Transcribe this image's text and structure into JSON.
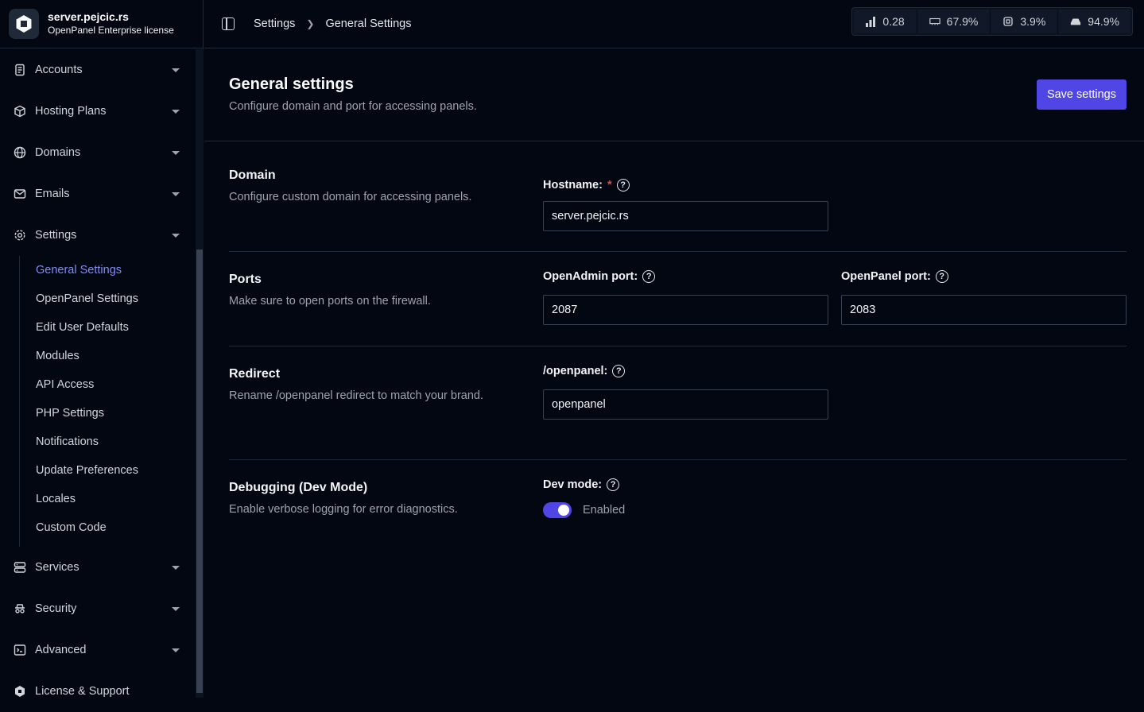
{
  "brand": {
    "server": "server.pejcic.rs",
    "license": "OpenPanel Enterprise license"
  },
  "sidebar": {
    "top_items": [
      {
        "label": "Accounts",
        "icon": "file-text-icon"
      },
      {
        "label": "Hosting Plans",
        "icon": "package-icon"
      },
      {
        "label": "Domains",
        "icon": "globe-icon"
      },
      {
        "label": "Emails",
        "icon": "mail-icon"
      },
      {
        "label": "Settings",
        "icon": "gear-icon"
      }
    ],
    "settings_sub": [
      "General Settings",
      "OpenPanel Settings",
      "Edit User Defaults",
      "Modules",
      "API Access",
      "PHP Settings",
      "Notifications",
      "Update Preferences",
      "Locales",
      "Custom Code"
    ],
    "bottom_items": [
      {
        "label": "Services",
        "icon": "server-icon"
      },
      {
        "label": "Security",
        "icon": "spy-icon"
      },
      {
        "label": "Advanced",
        "icon": "terminal-icon"
      },
      {
        "label": "License & Support",
        "icon": "openpanel-icon"
      }
    ]
  },
  "breadcrumb": {
    "parent": "Settings",
    "current": "General Settings"
  },
  "stats": {
    "load": "0.28",
    "ram": "67.9%",
    "cpu": "3.9%",
    "disk": "94.9%"
  },
  "page": {
    "title": "General settings",
    "description": "Configure domain and port for accessing panels.",
    "save_label": "Save settings"
  },
  "sections": {
    "domain": {
      "title": "Domain",
      "desc": "Configure custom domain for accessing panels.",
      "hostname_label": "Hostname:",
      "required_mark": "*",
      "hostname_value": "server.pejcic.rs"
    },
    "ports": {
      "title": "Ports",
      "desc": "Make sure to open ports on the firewall.",
      "openadmin_label": "OpenAdmin port:",
      "openadmin_value": "2087",
      "openpanel_label": "OpenPanel port:",
      "openpanel_value": "2083"
    },
    "redirect": {
      "title": "Redirect",
      "desc": "Rename /openpanel redirect to match your brand.",
      "label": "/openpanel:",
      "value": "openpanel"
    },
    "debug": {
      "title": "Debugging (Dev Mode)",
      "desc": "Enable verbose logging for error diagnostics.",
      "label": "Dev mode:",
      "state": "Enabled",
      "enabled": true
    }
  },
  "colors": {
    "accent": "#4f46e5",
    "active_link": "#818cf8",
    "background": "#030712"
  }
}
